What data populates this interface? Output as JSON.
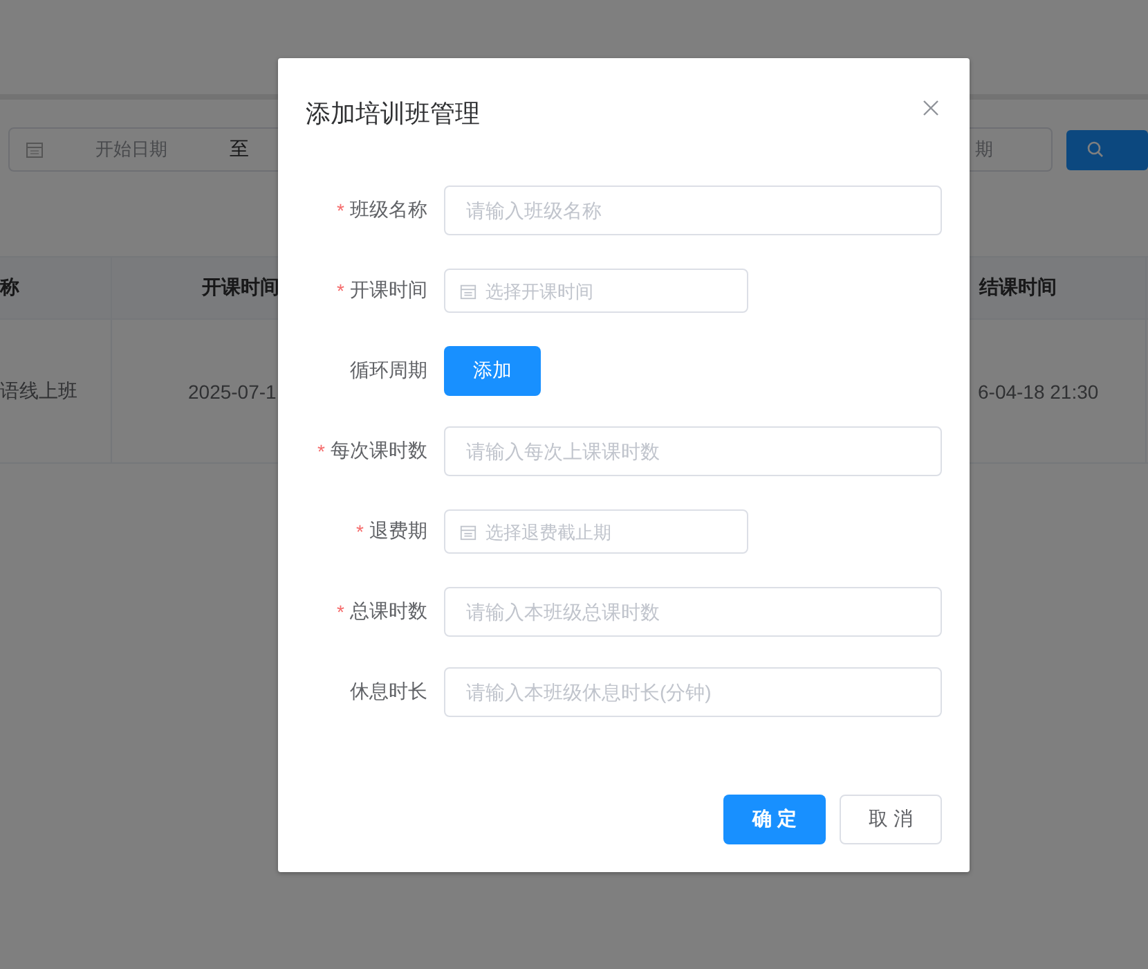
{
  "background": {
    "date_range": {
      "start_placeholder": "开始日期",
      "separator": "至",
      "end_placeholder": "期"
    },
    "table": {
      "columns": [
        "称",
        "开课时间",
        "结课时间"
      ],
      "rows": [
        [
          "语线上班",
          "2025-07-1",
          "6-04-18 21:30"
        ]
      ]
    }
  },
  "dialog": {
    "title": "添加培训班管理",
    "fields": [
      {
        "label": "班级名称",
        "required_mark": "*",
        "kind": "text",
        "placeholder": "请输入班级名称"
      },
      {
        "label": "开课时间",
        "required_mark": "*",
        "kind": "date",
        "placeholder": "选择开课时间"
      },
      {
        "label": "循环周期",
        "kind": "button",
        "button": "添加"
      },
      {
        "label": "每次课时数",
        "required_mark": "*",
        "kind": "text",
        "placeholder": "请输入每次上课课时数"
      },
      {
        "label": "退费期",
        "required_mark": "*",
        "kind": "date",
        "placeholder": "选择退费截止期"
      },
      {
        "label": "总课时数",
        "required_mark": "*",
        "kind": "text",
        "placeholder": "请输入本班级总课时数"
      },
      {
        "label": "休息时长",
        "kind": "text",
        "placeholder": "请输入本班级休息时长(分钟)"
      }
    ],
    "buttons": [
      {
        "label": "确 定",
        "kind": "primary"
      },
      {
        "label": "取 消",
        "kind": "default"
      }
    ]
  }
}
